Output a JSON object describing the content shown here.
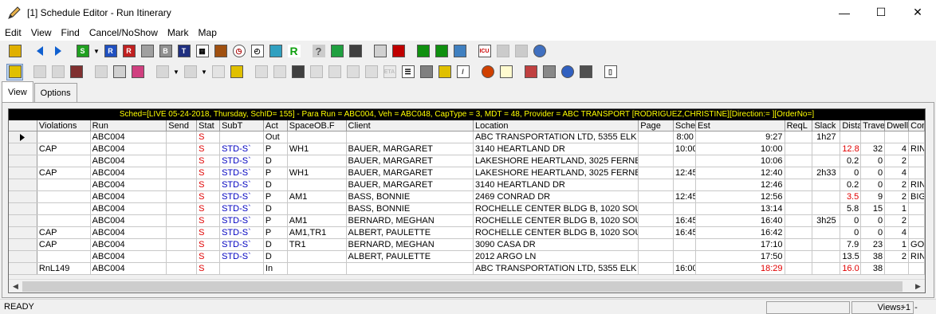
{
  "window": {
    "title": "[1] Schedule Editor - Run Itinerary",
    "minimize": "—",
    "maximize": "☐",
    "close": "✕"
  },
  "menu": [
    "Edit",
    "View",
    "Find",
    "Cancel/NoShow",
    "Mark",
    "Map"
  ],
  "tabs": {
    "view": "View",
    "options": "Options"
  },
  "banner": "Sched=[LIVE 05-24-2018, Thursday, SchID= 155] - Para Run = ABC004, Veh = ABC048, CapType = 3, MDT = 48, Provider = ABC TRANSPORT [RODRIGUEZ,CHRISTINE][Direction:= ][OrderNo=]",
  "columns": [
    "Violations",
    "Run",
    "Send",
    "Stat",
    "SubT",
    "Act",
    "SpaceOB.F",
    "Client",
    "Location",
    "Page",
    "Sched",
    "Est",
    "ReqL",
    "Slack",
    "Dista",
    "Trave",
    "Dwell",
    "Con"
  ],
  "rows": [
    {
      "violations": "",
      "run": "ABC004",
      "send": "",
      "stat": "S",
      "subt": "",
      "act": "Out",
      "space": "",
      "client": "",
      "location": "ABC TRANSPORTATION LTD, 5355 ELK",
      "page": "",
      "sched": "8:00",
      "est": "9:27",
      "est_red": false,
      "reql": "",
      "slack": "1h27",
      "dista": "",
      "dista_red": false,
      "trave": "",
      "dwell": "",
      "con": "",
      "current": true
    },
    {
      "violations": "CAP",
      "run": "ABC004",
      "send": "",
      "stat": "S",
      "subt": "STD-S`",
      "act": "P",
      "space": "WH1",
      "client": "BAUER, MARGARET",
      "location": " 3140 HEARTLAND DR",
      "page": "",
      "sched": "10:00",
      "est": "10:00",
      "est_red": false,
      "reql": "",
      "slack": "",
      "dista": "12.8",
      "dista_red": true,
      "trave": "32",
      "dwell": "4",
      "con": "RIN"
    },
    {
      "violations": "",
      "run": "ABC004",
      "send": "",
      "stat": "S",
      "subt": "STD-S`",
      "act": "D",
      "space": "",
      "client": "BAUER, MARGARET",
      "location": "LAKESHORE HEARTLAND, 3025 FERNB",
      "page": "",
      "sched": "",
      "est": "10:06",
      "est_red": false,
      "reql": "",
      "slack": "",
      "dista": "0.2",
      "dista_red": false,
      "trave": "0",
      "dwell": "2",
      "con": ""
    },
    {
      "violations": "CAP",
      "run": "ABC004",
      "send": "",
      "stat": "S",
      "subt": "STD-S`",
      "act": "P",
      "space": "WH1",
      "client": "BAUER, MARGARET",
      "location": "LAKESHORE HEARTLAND, 3025 FERNB",
      "page": "",
      "sched": "12:45",
      "est": "12:40",
      "est_red": false,
      "reql": "",
      "slack": "2h33",
      "dista": "0",
      "dista_red": false,
      "trave": "0",
      "dwell": "4",
      "con": ""
    },
    {
      "violations": "",
      "run": "ABC004",
      "send": "",
      "stat": "S",
      "subt": "STD-S`",
      "act": "D",
      "space": "",
      "client": "BAUER, MARGARET",
      "location": " 3140 HEARTLAND DR",
      "page": "",
      "sched": "",
      "est": "12:46",
      "est_red": false,
      "reql": "",
      "slack": "",
      "dista": "0.2",
      "dista_red": false,
      "trave": "0",
      "dwell": "2",
      "con": "RIN"
    },
    {
      "violations": "",
      "run": "ABC004",
      "send": "",
      "stat": "S",
      "subt": "STD-S`",
      "act": "P",
      "space": "AM1",
      "client": "BASS, BONNIE",
      "location": " 2469 CONRAD DR",
      "page": "",
      "sched": "12:45",
      "est": "12:56",
      "est_red": false,
      "reql": "",
      "slack": "",
      "dista": "3.5",
      "dista_red": true,
      "trave": "9",
      "dwell": "2",
      "con": "BIG"
    },
    {
      "violations": "",
      "run": "ABC004",
      "send": "",
      "stat": "S",
      "subt": "STD-S`",
      "act": "D",
      "space": "",
      "client": "BASS, BONNIE",
      "location": "ROCHELLE CENTER BLDG B, 1020 SOU",
      "page": "",
      "sched": "",
      "est": "13:14",
      "est_red": false,
      "reql": "",
      "slack": "",
      "dista": "5.8",
      "dista_red": false,
      "trave": "15",
      "dwell": "1",
      "con": ""
    },
    {
      "violations": "",
      "run": "ABC004",
      "send": "",
      "stat": "S",
      "subt": "STD-S`",
      "act": "P",
      "space": "AM1",
      "client": "BERNARD, MEGHAN",
      "location": "ROCHELLE CENTER BLDG B, 1020 SOU",
      "page": "",
      "sched": "16:45",
      "est": "16:40",
      "est_red": false,
      "reql": "",
      "slack": "3h25",
      "dista": "0",
      "dista_red": false,
      "trave": "0",
      "dwell": "2",
      "con": ""
    },
    {
      "violations": "CAP",
      "run": "ABC004",
      "send": "",
      "stat": "S",
      "subt": "STD-S`",
      "act": "P",
      "space": "AM1,TR1",
      "client": "ALBERT, PAULETTE",
      "location": "ROCHELLE CENTER BLDG B, 1020 SOU",
      "page": "",
      "sched": "16:45",
      "est": "16:42",
      "est_red": false,
      "reql": "",
      "slack": "",
      "dista": "0",
      "dista_red": false,
      "trave": "0",
      "dwell": "4",
      "con": ""
    },
    {
      "violations": "CAP",
      "run": "ABC004",
      "send": "",
      "stat": "S",
      "subt": "STD-S`",
      "act": "D",
      "space": "TR1",
      "client": "BERNARD, MEGHAN",
      "location": " 3090 CASA DR",
      "page": "",
      "sched": "",
      "est": "17:10",
      "est_red": false,
      "reql": "",
      "slack": "",
      "dista": "7.9",
      "dista_red": false,
      "trave": "23",
      "dwell": "1",
      "con": "GO"
    },
    {
      "violations": "",
      "run": "ABC004",
      "send": "",
      "stat": "S",
      "subt": "STD-S`",
      "act": "D",
      "space": "",
      "client": "ALBERT, PAULETTE",
      "location": " 2012 ARGO LN",
      "page": "",
      "sched": "",
      "est": "17:50",
      "est_red": false,
      "reql": "",
      "slack": "",
      "dista": "13.5",
      "dista_red": false,
      "trave": "38",
      "dwell": "2",
      "con": "RIN"
    },
    {
      "violations": "RnL149",
      "run": "ABC004",
      "send": "",
      "stat": "S",
      "subt": "",
      "act": "In",
      "space": "",
      "client": "",
      "location": "ABC TRANSPORTATION LTD, 5355 ELK",
      "page": "",
      "sched": "16:00",
      "est": "18:29",
      "est_red": true,
      "reql": "",
      "slack": "",
      "dista": "16.0",
      "dista_red": true,
      "trave": "38",
      "dwell": "",
      "con": ""
    }
  ],
  "status": {
    "text": "READY",
    "views_label": "Views:",
    "views_count": "1",
    "plus": "+",
    "minus": "-"
  }
}
